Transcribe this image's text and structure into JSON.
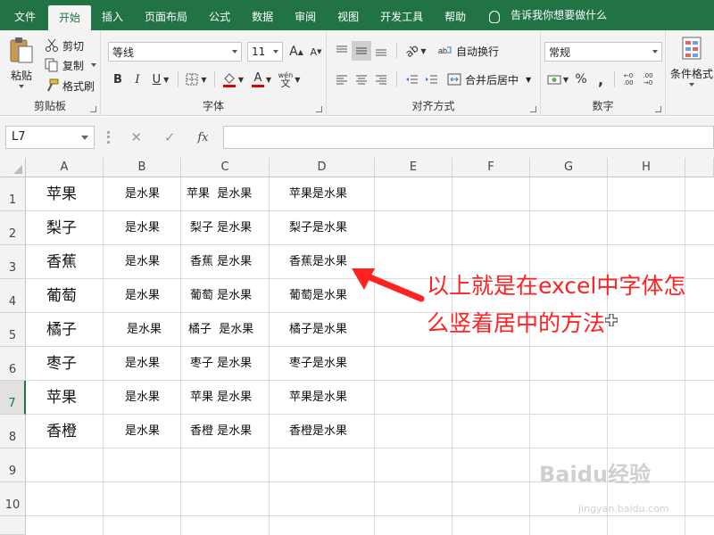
{
  "tabs": [
    "文件",
    "开始",
    "插入",
    "页面布局",
    "公式",
    "数据",
    "审阅",
    "视图",
    "开发工具",
    "帮助"
  ],
  "active_tab": "开始",
  "tell_me": "告诉我你想要做什么",
  "clipboard": {
    "paste": "粘贴",
    "cut": "剪切",
    "copy": "复制",
    "format_painter": "格式刷",
    "label": "剪贴板"
  },
  "font": {
    "name": "等线",
    "size": "11",
    "label": "字体",
    "bold": "B",
    "italic": "I",
    "underline": "U",
    "grow": "A",
    "shrink": "A",
    "phonetic": "wén"
  },
  "alignment": {
    "wrap": "自动换行",
    "merge": "合并后居中",
    "label": "对齐方式"
  },
  "number": {
    "format": "常规",
    "percent": "%",
    "comma": ",",
    "inc_decimal": ".00",
    "dec_decimal": ".00",
    "label": "数字"
  },
  "styles": {
    "conditional": "条件格式"
  },
  "formula_bar": {
    "name_box": "L7",
    "fx": "fx",
    "value": ""
  },
  "columns": [
    "A",
    "B",
    "C",
    "D",
    "E",
    "F",
    "G",
    "H"
  ],
  "rows": [
    "1",
    "2",
    "3",
    "4",
    "5",
    "6",
    "7",
    "8",
    "9",
    "10"
  ],
  "selected_row": "7",
  "cells": [
    {
      "a": "苹果",
      "b": "是水果",
      "c": "苹果  是水果",
      "d": "苹果是水果"
    },
    {
      "a": "梨子",
      "b": "是水果",
      "c": "梨子 是水果",
      "d": "梨子是水果"
    },
    {
      "a": "香蕉",
      "b": "是水果",
      "c": "香蕉 是水果",
      "d": "香蕉是水果"
    },
    {
      "a": "葡萄",
      "b": "是水果",
      "c": "葡萄 是水果",
      "d": "葡萄是水果"
    },
    {
      "a": "橘子",
      "b": "是水果",
      "c": "橘子  是水果",
      "d": "橘子是水果"
    },
    {
      "a": "枣子",
      "b": "是水果",
      "c": "枣子 是水果",
      "d": "枣子是水果"
    },
    {
      "a": "苹果",
      "b": "是水果",
      "c": "苹果 是水果",
      "d": "苹果是水果"
    },
    {
      "a": "香橙",
      "b": "是水果",
      "c": "香橙 是水果",
      "d": "香橙是水果"
    }
  ],
  "annotation": "以上就是在excel中字体怎么竖着居中的方法",
  "watermark": "Baidu经验",
  "watermark_sub": "jingyan.baidu.com",
  "colors": {
    "accent": "#217346",
    "annotation": "#ff2222",
    "font_red": "#e00000"
  }
}
